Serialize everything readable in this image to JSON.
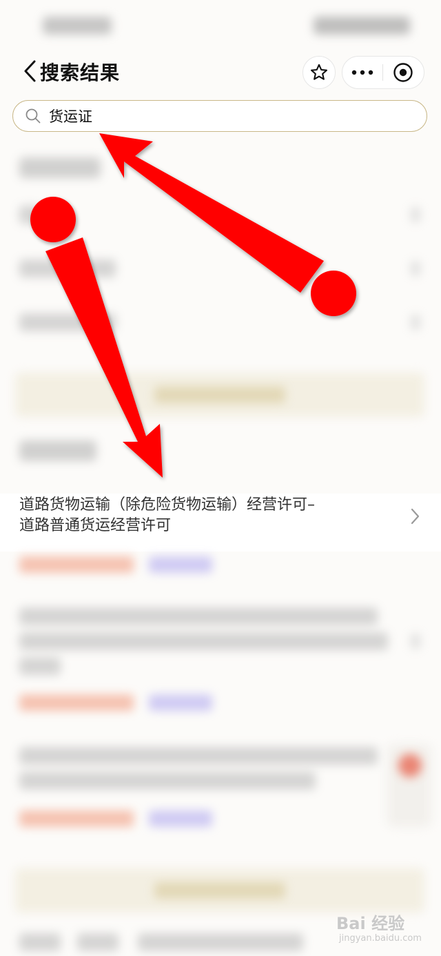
{
  "header": {
    "title": "搜索结果",
    "icons": {
      "back": "chevron-left-icon",
      "favorite": "star-icon",
      "more": "more-dots-icon",
      "close": "target-circle-icon"
    }
  },
  "search": {
    "value": "货运证",
    "icon": "search-icon",
    "border_color": "#c9b889"
  },
  "result": {
    "title_line1": "道路货物运输（除危险货物运输）经营许可–",
    "title_line2": "道路普通货运经营许可",
    "icon": "chevron-right-icon"
  },
  "watermark": {
    "main": "Bai 经验",
    "sub": "jingyan.baidu.com"
  },
  "colors": {
    "annotation_red": "#ff0000",
    "accent_gold": "#c9b889"
  }
}
